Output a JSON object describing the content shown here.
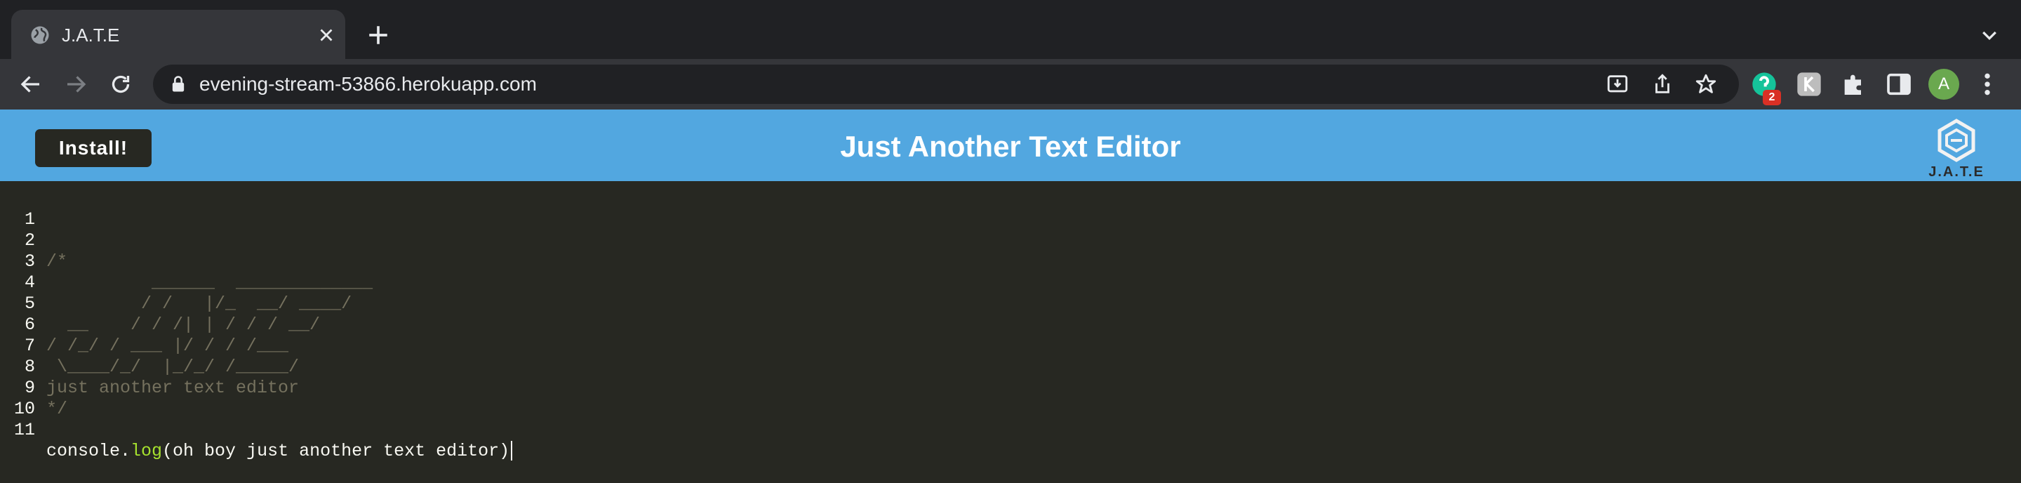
{
  "browser": {
    "tab": {
      "title": "J.A.T.E"
    },
    "url": "evening-stream-53866.herokuapp.com",
    "extension_badge": "2",
    "profile_initial": "A"
  },
  "app": {
    "install_label": "Install!",
    "title": "Just Another Text Editor",
    "logo_text": "J.A.T.E"
  },
  "editor": {
    "lines": [
      {
        "num": "1",
        "text": ""
      },
      {
        "num": "2",
        "text": "/*"
      },
      {
        "num": "3",
        "text": "          ______  _____________"
      },
      {
        "num": "4",
        "text": "         / /   |/_  __/ ____/"
      },
      {
        "num": "5",
        "text": "  __    / / /| | / / / __/"
      },
      {
        "num": "6",
        "text": "/ /_/ / ___ |/ / / /___"
      },
      {
        "num": "7",
        "text": " \\____/_/  |_/_/ /_____/"
      },
      {
        "num": "8",
        "text": "just another text editor"
      },
      {
        "num": "9",
        "text": "*/"
      },
      {
        "num": "10",
        "text": ""
      },
      {
        "num": "11",
        "pre": "console.",
        "fn": "log",
        "post": "(oh boy just another text editor)"
      }
    ]
  },
  "colors": {
    "header_bg": "#52a7e0",
    "editor_bg": "#272822",
    "comment": "#75715e",
    "function": "#a6e22e"
  }
}
